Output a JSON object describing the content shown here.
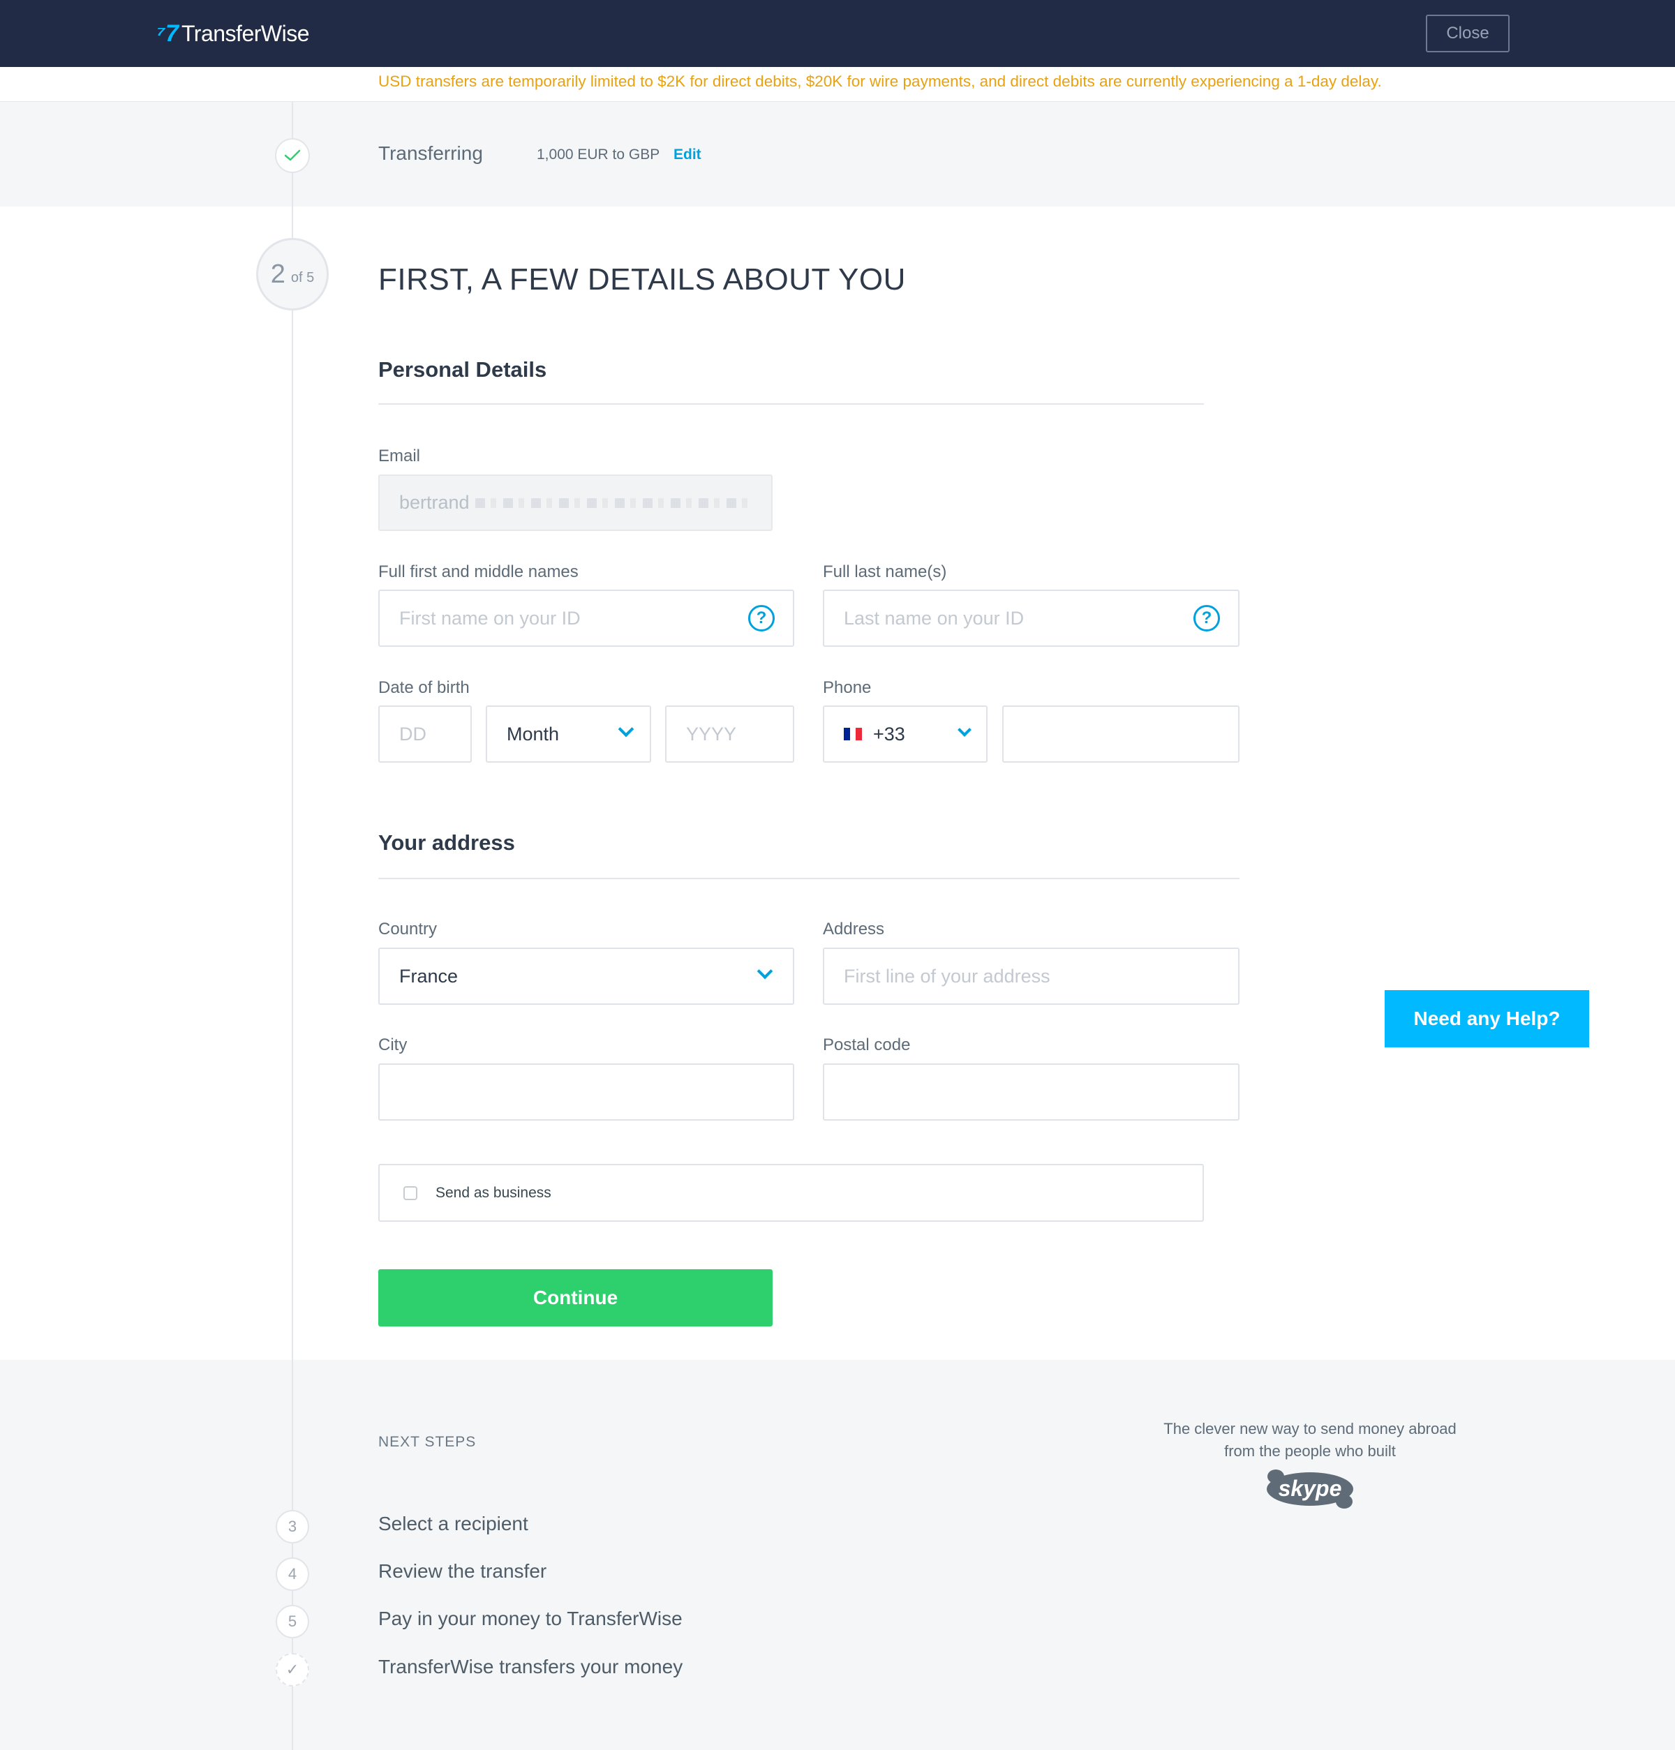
{
  "header": {
    "logo_mark": "⁷7",
    "logo_text": "TransferWise",
    "close_label": "Close"
  },
  "banner": {
    "text": "USD transfers are temporarily limited to $2K for direct debits, $20K for wire payments, and direct debits are currently experiencing a 1-day delay."
  },
  "transfer": {
    "label": "Transferring",
    "value": "1,000 EUR to GBP",
    "edit_label": "Edit"
  },
  "progress": {
    "current": "2",
    "total": "of 5"
  },
  "page_title": "FIRST, A FEW DETAILS ABOUT YOU",
  "personal": {
    "title": "Personal Details",
    "email_label": "Email",
    "email_value": "bertrand",
    "first_label": "Full first and middle names",
    "first_placeholder": "First name on your ID",
    "last_label": "Full last name(s)",
    "last_placeholder": "Last name on your ID",
    "help_glyph": "?",
    "dob_label": "Date of birth",
    "dd_placeholder": "DD",
    "month_value": "Month",
    "yyyy_placeholder": "YYYY",
    "phone_label": "Phone",
    "phone_code": "+33",
    "flag_colors": [
      "#002395",
      "#ffffff",
      "#ed2939"
    ]
  },
  "address": {
    "title": "Your address",
    "country_label": "Country",
    "country_value": "France",
    "address_label": "Address",
    "address_placeholder": "First line of your address",
    "city_label": "City",
    "postal_label": "Postal code"
  },
  "business_label": "Send as business",
  "continue_label": "Continue",
  "help_button_label": "Need any Help?",
  "next_steps": {
    "title": "NEXT STEPS",
    "items": [
      {
        "number": "3",
        "label": "Select a recipient"
      },
      {
        "number": "4",
        "label": "Review the transfer"
      },
      {
        "number": "5",
        "label": "Pay in your money to TransferWise"
      },
      {
        "number": "✓",
        "label": "TransferWise transfers your money"
      }
    ]
  },
  "tagline": {
    "line1": "The clever new way to send money abroad",
    "line2": "from the people who built",
    "brand": "skype"
  },
  "colors": {
    "header_bg": "#212b45",
    "brand_blue": "#00b9ff",
    "link_blue": "#00a2dd",
    "warning": "#e8a210",
    "success_green": "#2ed06e"
  }
}
